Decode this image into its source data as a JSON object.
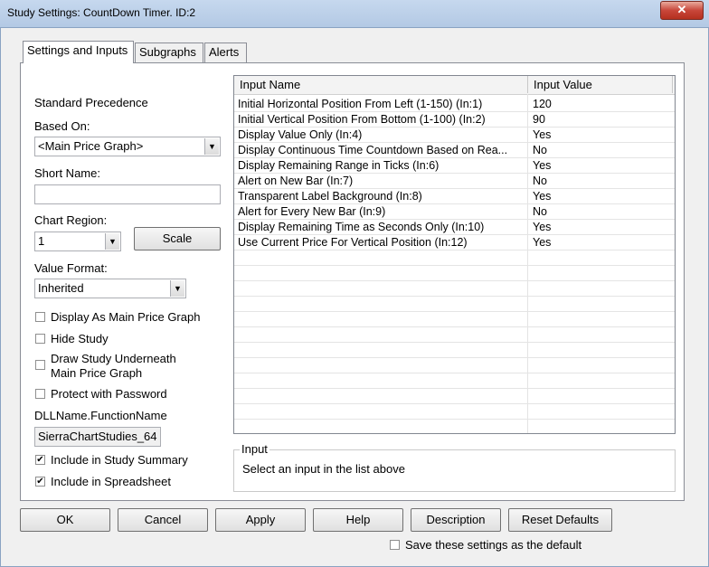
{
  "window": {
    "title": "Study Settings: CountDown Timer. ID:2",
    "close_glyph": "✕"
  },
  "tabs": [
    {
      "label": "Settings and Inputs"
    },
    {
      "label": "Subgraphs"
    },
    {
      "label": "Alerts"
    }
  ],
  "left": {
    "standard_precedence": "Standard Precedence",
    "based_on_label": "Based On:",
    "based_on_value": "<Main Price Graph>",
    "short_name_label": "Short Name:",
    "short_name_value": "",
    "chart_region_label": "Chart Region:",
    "chart_region_value": "1",
    "scale_button": "Scale",
    "value_format_label": "Value Format:",
    "value_format_value": "Inherited",
    "checkboxes": [
      {
        "label": "Display As Main Price Graph",
        "checked": false
      },
      {
        "label": "Hide Study",
        "checked": false
      },
      {
        "label": "Draw Study Underneath",
        "label2": "Main Price Graph",
        "checked": false
      },
      {
        "label": "Protect with Password",
        "checked": false
      }
    ],
    "dll_label": "DLLName.FunctionName",
    "dll_value": "SierraChartStudies_64",
    "include_summary": {
      "label": "Include in Study Summary",
      "checked": true
    },
    "include_spreadsheet": {
      "label": "Include in Spreadsheet",
      "checked": true
    }
  },
  "inputs_table": {
    "columns": [
      "Input Name",
      "Input Value"
    ],
    "rows": [
      {
        "name": "Initial Horizontal Position From Left (1-150)   (In:1)",
        "value": "120"
      },
      {
        "name": "Initial Vertical Position From Bottom (1-100)   (In:2)",
        "value": "90"
      },
      {
        "name": "Display Value Only   (In:4)",
        "value": "Yes"
      },
      {
        "name": "Display Continuous Time Countdown Based on Rea...",
        "value": "No"
      },
      {
        "name": "Display Remaining Range in Ticks   (In:6)",
        "value": "Yes"
      },
      {
        "name": "Alert on New Bar   (In:7)",
        "value": "No"
      },
      {
        "name": "Transparent Label Background   (In:8)",
        "value": "Yes"
      },
      {
        "name": "Alert for Every New Bar   (In:9)",
        "value": "No"
      },
      {
        "name": "Display Remaining Time as Seconds Only   (In:10)",
        "value": "Yes"
      },
      {
        "name": "Use Current Price For Vertical Position   (In:12)",
        "value": "Yes"
      }
    ]
  },
  "input_box": {
    "legend": "Input",
    "text": "Select an input in the list above"
  },
  "buttons": {
    "ok": "OK",
    "cancel": "Cancel",
    "apply": "Apply",
    "help": "Help",
    "description": "Description",
    "reset": "Reset Defaults"
  },
  "save_default": {
    "label": "Save these settings as the default",
    "checked": false
  }
}
